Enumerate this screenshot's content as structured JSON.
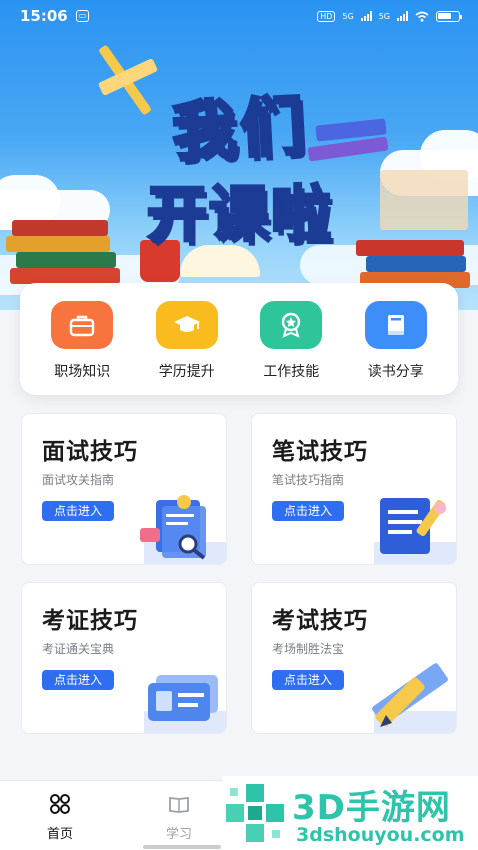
{
  "status_bar": {
    "time": "15:06",
    "battery_level": 0.7,
    "network_labels": [
      "5G",
      "5G"
    ]
  },
  "hero": {
    "line1": "我们",
    "line2": "开课啦"
  },
  "categories": [
    {
      "label": "职场知识",
      "icon": "briefcase-icon",
      "color": "#f8743f"
    },
    {
      "label": "学历提升",
      "icon": "graduation-cap-icon",
      "color": "#f9bb1e"
    },
    {
      "label": "工作技能",
      "icon": "award-medal-icon",
      "color": "#2fc59b"
    },
    {
      "label": "读书分享",
      "icon": "book-icon",
      "color": "#3d8ef8"
    }
  ],
  "cards": [
    {
      "title": "面试技巧",
      "subtitle": "面试攻关指南",
      "button": "点击进入",
      "icon": "interview-document-icon"
    },
    {
      "title": "笔试技巧",
      "subtitle": "笔试技巧指南",
      "button": "点击进入",
      "icon": "notebook-icon"
    },
    {
      "title": "考证技巧",
      "subtitle": "考证通关宝典",
      "button": "点击进入",
      "icon": "id-card-icon"
    },
    {
      "title": "考试技巧",
      "subtitle": "考场制胜法宝",
      "button": "点击进入",
      "icon": "pencil-ruler-icon"
    }
  ],
  "tabbar": {
    "tabs": [
      {
        "label": "首页",
        "active": true,
        "icon": "home-grid-icon"
      },
      {
        "label": "学习",
        "active": false,
        "icon": "open-book-icon"
      }
    ],
    "active_color": "#111111",
    "inactive_color": "#9aa0a8"
  },
  "watermark": {
    "text": "3D手游网",
    "url": "3dshouyou.com"
  },
  "colors": {
    "accent": "#2f6ef0",
    "watermark": "#2ec4a9"
  }
}
